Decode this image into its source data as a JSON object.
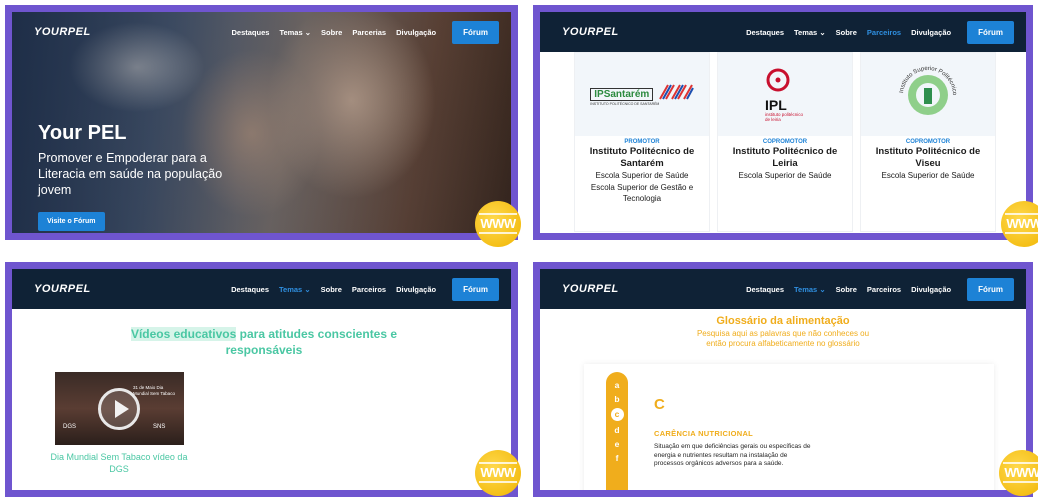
{
  "nav": {
    "logo": "YOURPEL",
    "items": [
      "Destaques",
      "Temas",
      "Sobre",
      "Parcerias",
      "Divulgação"
    ],
    "items_alt": [
      "Destaques",
      "Temas",
      "Sobre",
      "Parceiros",
      "Divulgação"
    ],
    "temas_arrow": "⌄",
    "forum_label": "Fórum"
  },
  "hero": {
    "title": "Your PEL",
    "subtitle": "Promover e Empoderar para a Literacia em saúde na população jovem",
    "button": "Visite o Fórum"
  },
  "partners": [
    {
      "logo_text": "IPSantarém",
      "logo_small": "INSTITUTO POLITÉCNICO DE SANTARÉM",
      "role": "PROMOTOR",
      "name": "Instituto Politécnico de Santarém",
      "schools": [
        "Escola Superior de Saúde",
        "Escola Superior de Gestão e Tecnologia"
      ]
    },
    {
      "logo_text": "IPL",
      "logo_small": "instituto politécnico de leiria",
      "role": "COPROMOTOR",
      "name": "Instituto Politécnico de Leiria",
      "schools": [
        "Escola Superior de Saúde"
      ]
    },
    {
      "logo_text": "Instituto Superior Politécnico de Viseu",
      "logo_small": "",
      "role": "COPROMOTOR",
      "name": "Instituto Politécnico de Viseu",
      "schools": [
        "Escola Superior de Saúde"
      ]
    }
  ],
  "videos": {
    "title_highlight": "Vídeos educativos",
    "title_rest": " para atitudes conscientes e responsáveis",
    "thumb_text": "31 de Maio Dia Mundial Sem Tabaco",
    "thumb_dgs": "DGS",
    "thumb_sns": "SNS",
    "caption": "Dia Mundial Sem Tabaco vídeo da DGS"
  },
  "glossary": {
    "title": "Glossário da alimentação",
    "subtitle": "Pesquisa aqui as palavras que não conheces ou então procura alfabeticamente no glossário",
    "letters": [
      "a",
      "b",
      "c",
      "d",
      "e",
      "f"
    ],
    "selected_letter": "c",
    "letter_heading": "C",
    "term": "CARÊNCIA NUTRICIONAL",
    "definition": "Situação em que deficiências gerais ou específicas de energia e nutrientes resultam na instalação de processos orgânicos adversos para a saúde."
  },
  "globe_text": "WWW",
  "colors": {
    "frame": "#6f55cf",
    "nav": "#0f2236",
    "forum": "#1d82d6",
    "teal": "#4ac7a3",
    "orange": "#f0ad1c"
  }
}
